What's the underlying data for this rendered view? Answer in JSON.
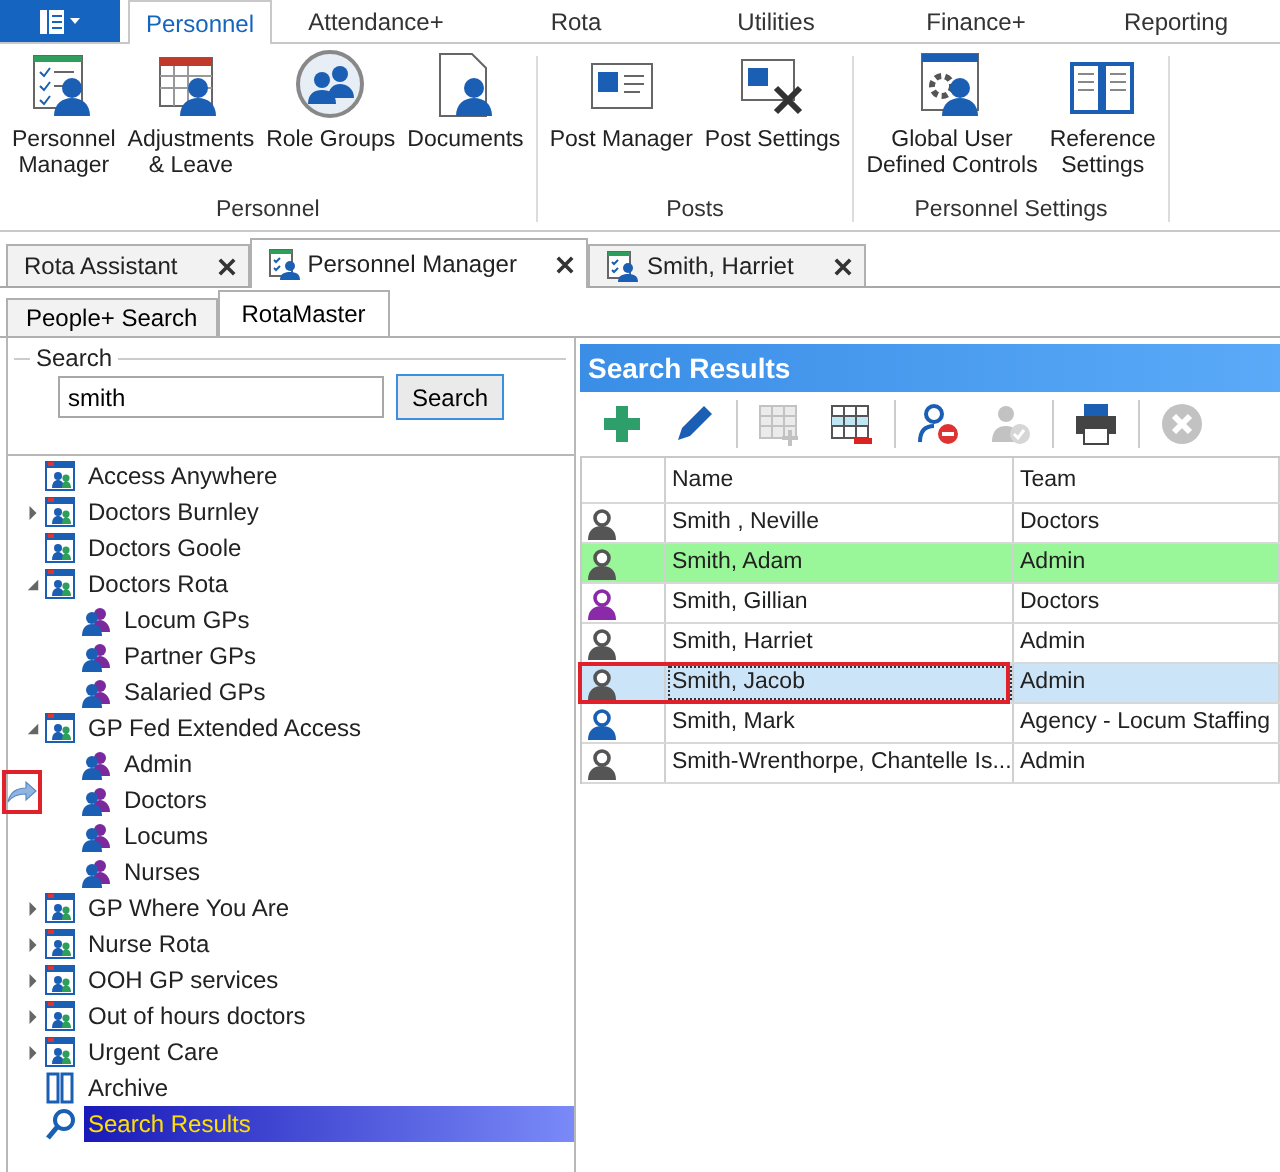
{
  "ribbon": {
    "tabs": [
      {
        "label": "Personnel",
        "selected": true
      },
      {
        "label": "Attendance+",
        "selected": false
      },
      {
        "label": "Rota",
        "selected": false
      },
      {
        "label": "Utilities",
        "selected": false
      },
      {
        "label": "Finance+",
        "selected": false
      },
      {
        "label": "Reporting",
        "selected": false
      }
    ],
    "groups": [
      {
        "label": "Personnel",
        "buttons": [
          {
            "kind": "checklist",
            "label": "Personnel\nManager"
          },
          {
            "kind": "calendar",
            "label": "Adjustments\n& Leave"
          },
          {
            "kind": "roles",
            "label": "Role Groups"
          },
          {
            "kind": "document",
            "label": "Documents"
          }
        ]
      },
      {
        "label": "Posts",
        "buttons": [
          {
            "kind": "card",
            "label": "Post Manager"
          },
          {
            "kind": "card-tools",
            "label": "Post Settings"
          }
        ]
      },
      {
        "label": "Personnel Settings",
        "buttons": [
          {
            "kind": "gear-window",
            "label": "Global User\nDefined Controls"
          },
          {
            "kind": "book",
            "label": "Reference\nSettings"
          }
        ]
      }
    ]
  },
  "document_tabs": [
    {
      "label": "Rota Assistant",
      "icon": false,
      "selected": false
    },
    {
      "label": "Personnel Manager",
      "icon": true,
      "selected": true
    },
    {
      "label": "Smith, Harriet",
      "icon": true,
      "selected": false
    }
  ],
  "sub_tabs": [
    {
      "label": "People+ Search",
      "selected": false
    },
    {
      "label": "RotaMaster",
      "selected": true
    }
  ],
  "search": {
    "legend": "Search",
    "value": "smith",
    "button": "Search"
  },
  "side_arrow": {
    "highlighted": true
  },
  "tree": [
    {
      "kind": "team",
      "label": "Access Anywhere",
      "expandable": false,
      "expanded": false,
      "selected": false
    },
    {
      "kind": "team",
      "label": "Doctors Burnley",
      "expandable": true,
      "expanded": false,
      "selected": false
    },
    {
      "kind": "team",
      "label": "Doctors Goole",
      "expandable": false,
      "expanded": false,
      "selected": false
    },
    {
      "kind": "team",
      "label": "Doctors Rota",
      "expandable": true,
      "expanded": true,
      "selected": false,
      "children": [
        {
          "kind": "group",
          "label": "Locum GPs",
          "expandable": false,
          "expanded": false,
          "selected": false
        },
        {
          "kind": "group",
          "label": "Partner GPs",
          "expandable": false,
          "expanded": false,
          "selected": false
        },
        {
          "kind": "group",
          "label": "Salaried GPs",
          "expandable": false,
          "expanded": false,
          "selected": false
        }
      ]
    },
    {
      "kind": "team",
      "label": "GP Fed Extended Access",
      "expandable": true,
      "expanded": true,
      "selected": false,
      "children": [
        {
          "kind": "group",
          "label": "Admin",
          "expandable": false,
          "expanded": false,
          "selected": false
        },
        {
          "kind": "group",
          "label": "Doctors",
          "expandable": false,
          "expanded": false,
          "selected": false
        },
        {
          "kind": "group",
          "label": "Locums",
          "expandable": false,
          "expanded": false,
          "selected": false
        },
        {
          "kind": "group",
          "label": "Nurses",
          "expandable": false,
          "expanded": false,
          "selected": false
        }
      ]
    },
    {
      "kind": "team",
      "label": "GP Where You Are",
      "expandable": true,
      "expanded": false,
      "selected": false
    },
    {
      "kind": "team",
      "label": "Nurse Rota",
      "expandable": true,
      "expanded": false,
      "selected": false
    },
    {
      "kind": "team",
      "label": "OOH GP services",
      "expandable": true,
      "expanded": false,
      "selected": false
    },
    {
      "kind": "team",
      "label": "Out of hours doctors",
      "expandable": true,
      "expanded": false,
      "selected": false
    },
    {
      "kind": "team",
      "label": "Urgent Care",
      "expandable": true,
      "expanded": false,
      "selected": false
    },
    {
      "kind": "archive",
      "label": "Archive",
      "expandable": false,
      "expanded": false,
      "selected": false
    },
    {
      "kind": "search",
      "label": "Search Results",
      "expandable": false,
      "expanded": false,
      "selected": true
    }
  ],
  "results": {
    "title": "Search Results",
    "toolbar": [
      {
        "kind": "add",
        "disabled": false
      },
      {
        "kind": "edit",
        "disabled": false
      },
      {
        "kind": "grid-add",
        "disabled": true
      },
      {
        "kind": "grid-remove",
        "disabled": false
      },
      {
        "kind": "user-remove",
        "disabled": false
      },
      {
        "kind": "user-check",
        "disabled": true
      },
      {
        "kind": "print",
        "disabled": false
      },
      {
        "kind": "cancel",
        "disabled": true
      }
    ],
    "columns": [
      "Name",
      "Team"
    ],
    "rows": [
      {
        "color": "#555555",
        "name": "Smith , Neville",
        "team": "Doctors",
        "flagged": false,
        "selected": false,
        "outlined": false
      },
      {
        "color": "#555555",
        "name": "Smith, Adam",
        "team": "Admin",
        "flagged": true,
        "selected": false,
        "outlined": false
      },
      {
        "color": "#8a2aa8",
        "name": "Smith, Gillian",
        "team": "Doctors",
        "flagged": false,
        "selected": false,
        "outlined": false
      },
      {
        "color": "#555555",
        "name": "Smith, Harriet",
        "team": "Admin",
        "flagged": false,
        "selected": false,
        "outlined": false
      },
      {
        "color": "#555555",
        "name": "Smith, Jacob",
        "team": "Admin",
        "flagged": false,
        "selected": true,
        "outlined": true
      },
      {
        "color": "#1a5fb4",
        "name": "Smith, Mark",
        "team": "Agency - Locum Staffing",
        "flagged": false,
        "selected": false,
        "outlined": false
      },
      {
        "color": "#555555",
        "name": "Smith-Wrenthorpe, Chantelle Is...",
        "team": "Admin",
        "flagged": false,
        "selected": false,
        "outlined": false
      }
    ]
  }
}
